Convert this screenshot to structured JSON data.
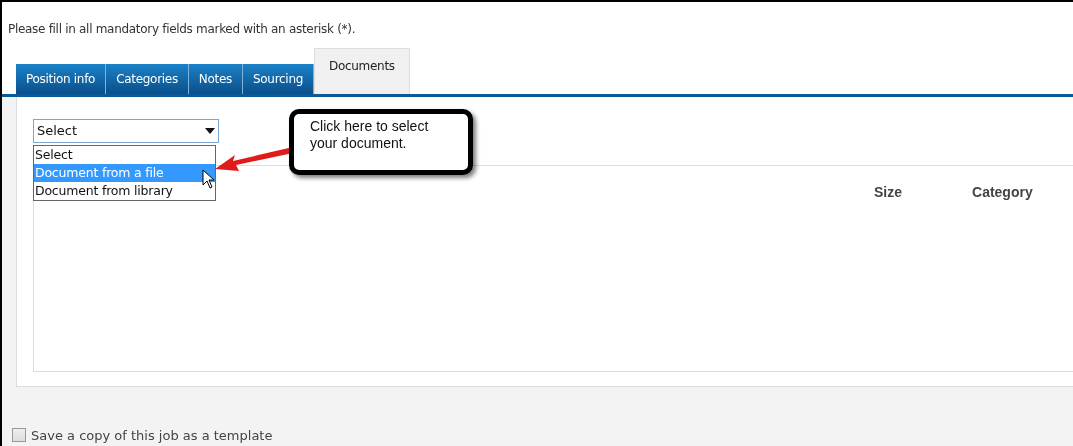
{
  "instruction": "Please fill in all mandatory fields marked with an asterisk (*).",
  "tabs": [
    {
      "label": "Position info",
      "selected": false
    },
    {
      "label": "Categories",
      "selected": false
    },
    {
      "label": "Notes",
      "selected": false
    },
    {
      "label": "Sourcing",
      "selected": false
    },
    {
      "label": "Documents",
      "selected": true
    }
  ],
  "document_select": {
    "value": "Select",
    "expanded": true,
    "options": [
      {
        "label": "Select",
        "highlighted": false
      },
      {
        "label": "Document from a file",
        "highlighted": true
      },
      {
        "label": "Document from library",
        "highlighted": false
      }
    ]
  },
  "callout": "Click here to select your document.",
  "table": {
    "columns": [
      "Size",
      "Category"
    ]
  },
  "template_checkbox": {
    "label": "Save a copy of this job as a template",
    "checked": false
  }
}
